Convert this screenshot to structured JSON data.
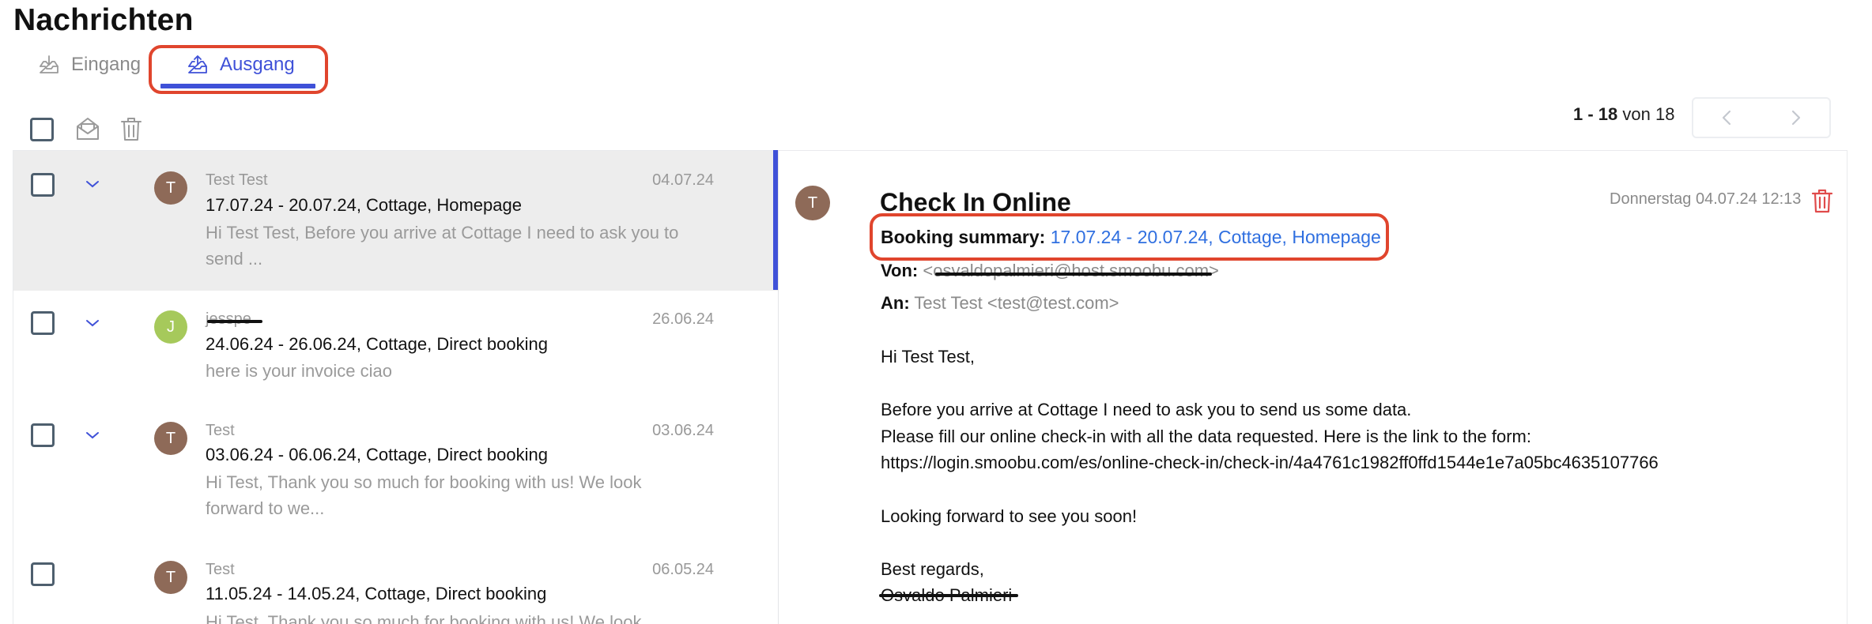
{
  "header": {
    "title": "Nachrichten"
  },
  "tabs": {
    "inbox": "Eingang",
    "outbox": "Ausgang"
  },
  "pagination": {
    "range": "1 - 18",
    "of_label": "von",
    "total": "18"
  },
  "messages": [
    {
      "avatar": "T",
      "avatar_color": "#8e6a58",
      "sender": "Test Test",
      "date": "04.07.24",
      "subject": "17.07.24 - 20.07.24, Cottage, Homepage",
      "preview_line1": "Hi Test Test, Before you arrive at Cottage I need to ask you to",
      "preview_line2": "send ..."
    },
    {
      "avatar": "J",
      "avatar_color": "#a6c95b",
      "sender": "jesspe",
      "date": "26.06.24",
      "subject": "24.06.24 - 26.06.24, Cottage, Direct booking",
      "preview_line1": "here is your invoice ciao"
    },
    {
      "avatar": "T",
      "avatar_color": "#8e6a58",
      "sender": "Test",
      "date": "03.06.24",
      "subject": "03.06.24 - 06.06.24, Cottage, Direct booking",
      "preview_line1": "Hi Test, Thank you so much for booking with us! We look",
      "preview_line2": "forward to we..."
    },
    {
      "avatar": "T",
      "avatar_color": "#8e6a58",
      "sender": "Test",
      "date": "06.05.24",
      "subject": "11.05.24 - 14.05.24, Cottage, Direct booking",
      "preview_line1": "Hi Test, Thank you so much for booking with us! We look"
    }
  ],
  "detail": {
    "avatar": "T",
    "subject": "Check In Online",
    "datetime": "Donnerstag 04.07.24 12:13",
    "summary_label": "Booking summary:",
    "summary_value": "17.07.24 - 20.07.24, Cottage, Homepage",
    "from_label": "Von:",
    "from_value": "<osvaldopalmieri@host.smoobu.com>",
    "to_label": "An:",
    "to_value": "Test Test <test@test.com>",
    "body": {
      "greeting": "Hi Test Test,",
      "line1": "Before you arrive at Cottage I need to ask you to send us some data.",
      "line2": "Please fill our online check-in with all the data requested. Here is the link to the form:",
      "line3": "https://login.smoobu.com/es/online-check-in/check-in/4a4761c1982ff0ffd1544e1e7a05bc4635107766",
      "line4": "Looking forward to see you soon!",
      "closing": "Best regards,",
      "signature": "Osvaldo Palmieri"
    }
  },
  "colors": {
    "accent": "#3f51d8",
    "highlight": "#e0452d",
    "link": "#2f6fe0",
    "trash": "#e04b4b"
  }
}
